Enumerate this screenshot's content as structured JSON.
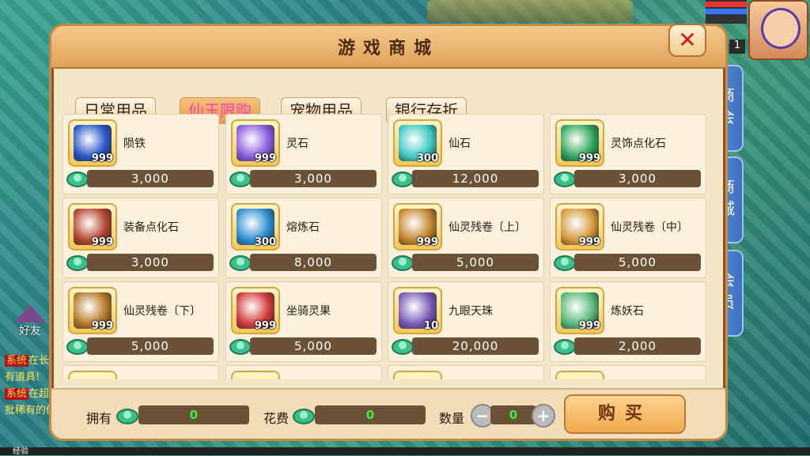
{
  "window": {
    "title": "游戏商城",
    "close_icon": "close-icon"
  },
  "tabs": [
    {
      "label": "日常用品"
    },
    {
      "label": "仙玉限购",
      "active": true
    },
    {
      "label": "宠物用品"
    },
    {
      "label": "银行存折"
    }
  ],
  "side_tabs": [
    "商会",
    "商城",
    "会员"
  ],
  "items": [
    {
      "name": "陨铁",
      "qty": "999",
      "price": "3,000",
      "icon": "meteor-iron-icon",
      "color": "#2b57c9"
    },
    {
      "name": "灵石",
      "qty": "999",
      "price": "3,000",
      "icon": "spirit-crystal-icon",
      "color": "#8a5ee0"
    },
    {
      "name": "仙石",
      "qty": "300",
      "price": "12,000",
      "icon": "immortal-stone-icon",
      "color": "#3fc9c2"
    },
    {
      "name": "灵饰点化石",
      "qty": "999",
      "price": "3,000",
      "icon": "potion-bottle-icon",
      "color": "#2fa85a"
    },
    {
      "name": "装备点化石",
      "qty": "999",
      "price": "3,000",
      "icon": "gourd-icon",
      "color": "#b5452f"
    },
    {
      "name": "熔炼石",
      "qty": "300",
      "price": "8,000",
      "icon": "smelting-stone-icon",
      "color": "#2b8fd0"
    },
    {
      "name": "仙灵残卷〔上〕",
      "qty": "999",
      "price": "5,000",
      "icon": "scroll-icon",
      "color": "#c4862e"
    },
    {
      "name": "仙灵残卷〔中〕",
      "qty": "999",
      "price": "5,000",
      "icon": "scroll-icon",
      "color": "#d59a3b"
    },
    {
      "name": "仙灵残卷〔下〕",
      "qty": "999",
      "price": "5,000",
      "icon": "scroll-icon",
      "color": "#b77a2a"
    },
    {
      "name": "坐骑灵果",
      "qty": "999",
      "price": "5,000",
      "icon": "strawberry-icon",
      "color": "#d23b3b"
    },
    {
      "name": "九眼天珠",
      "qty": "10",
      "price": "20,000",
      "icon": "bead-icon",
      "color": "#7a5bb8"
    },
    {
      "name": "炼妖石",
      "qty": "999",
      "price": "2,000",
      "icon": "green-crystal-icon",
      "color": "#5ab87a"
    }
  ],
  "bottom": {
    "own_label": "拥有",
    "own_value": "0",
    "cost_label": "花费",
    "cost_value": "0",
    "qty_label": "数量",
    "qty_value": "0",
    "minus": "−",
    "plus": "+",
    "buy_label": "购买"
  },
  "hud": {
    "friend_label": "好友",
    "level": "1",
    "chat": [
      {
        "tag": "系统",
        "text": "在长"
      },
      {
        "text": "有道具!"
      },
      {
        "tag": "系统",
        "text": "在超"
      },
      {
        "text": "批稀有的传"
      }
    ],
    "exp_label": "经验"
  },
  "colors": {
    "jade_currency": "#3cbf8a",
    "price_bar": "#6b5236",
    "active_tab_text": "#ff3fb5"
  }
}
